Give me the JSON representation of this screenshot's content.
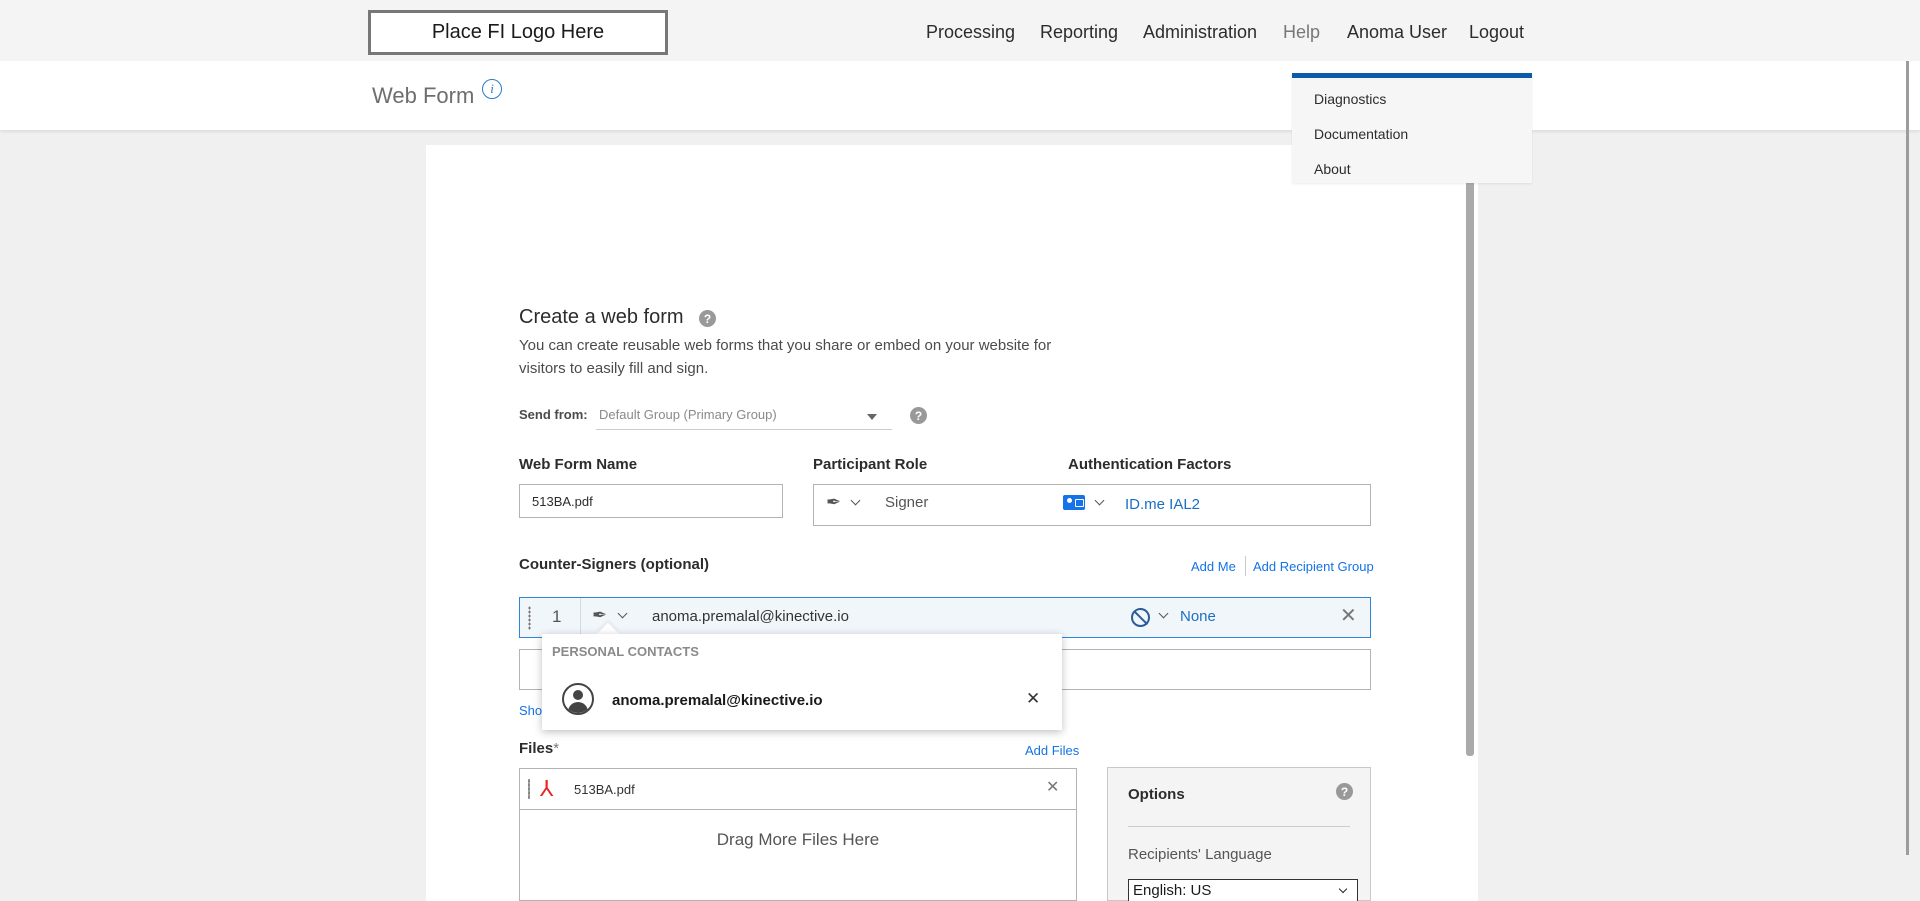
{
  "header": {
    "logo_text": "Place FI Logo Here",
    "nav": [
      "Processing",
      "Reporting",
      "Administration",
      "Help",
      "Anoma User",
      "Logout"
    ]
  },
  "page": {
    "title": "Web Form"
  },
  "help_menu": {
    "items": [
      "Diagnostics",
      "Documentation",
      "About"
    ]
  },
  "form": {
    "heading": "Create a web form",
    "description": "You can create reusable web forms that you share or embed on your website for visitors to easily fill and sign.",
    "send_from": {
      "label": "Send from:",
      "value": "Default Group (Primary Group)"
    },
    "web_form_name": {
      "label": "Web Form Name",
      "value": "513BA.pdf"
    },
    "participant_role": {
      "label": "Participant Role",
      "value": "Signer"
    },
    "authentication": {
      "label": "Authentication Factors",
      "value": "ID.me IAL2"
    },
    "counter_signers": {
      "label": "Counter-Signers (optional)",
      "add_me": "Add Me",
      "add_group": "Add Recipient Group",
      "rows": [
        {
          "index": "1",
          "email": "anoma.premalal@kinective.io",
          "auth": "None"
        }
      ]
    },
    "show_link_partial": "Sho",
    "contacts_popup": {
      "heading": "PERSONAL CONTACTS",
      "email": "anoma.premalal@kinective.io"
    },
    "files": {
      "label": "Files",
      "required_mark": "*",
      "add_files": "Add Files",
      "items": [
        "513BA.pdf"
      ],
      "drop_hint": "Drag More Files Here"
    },
    "options": {
      "title": "Options",
      "recipients_language_label": "Recipients' Language",
      "language_value": "English: US"
    }
  }
}
